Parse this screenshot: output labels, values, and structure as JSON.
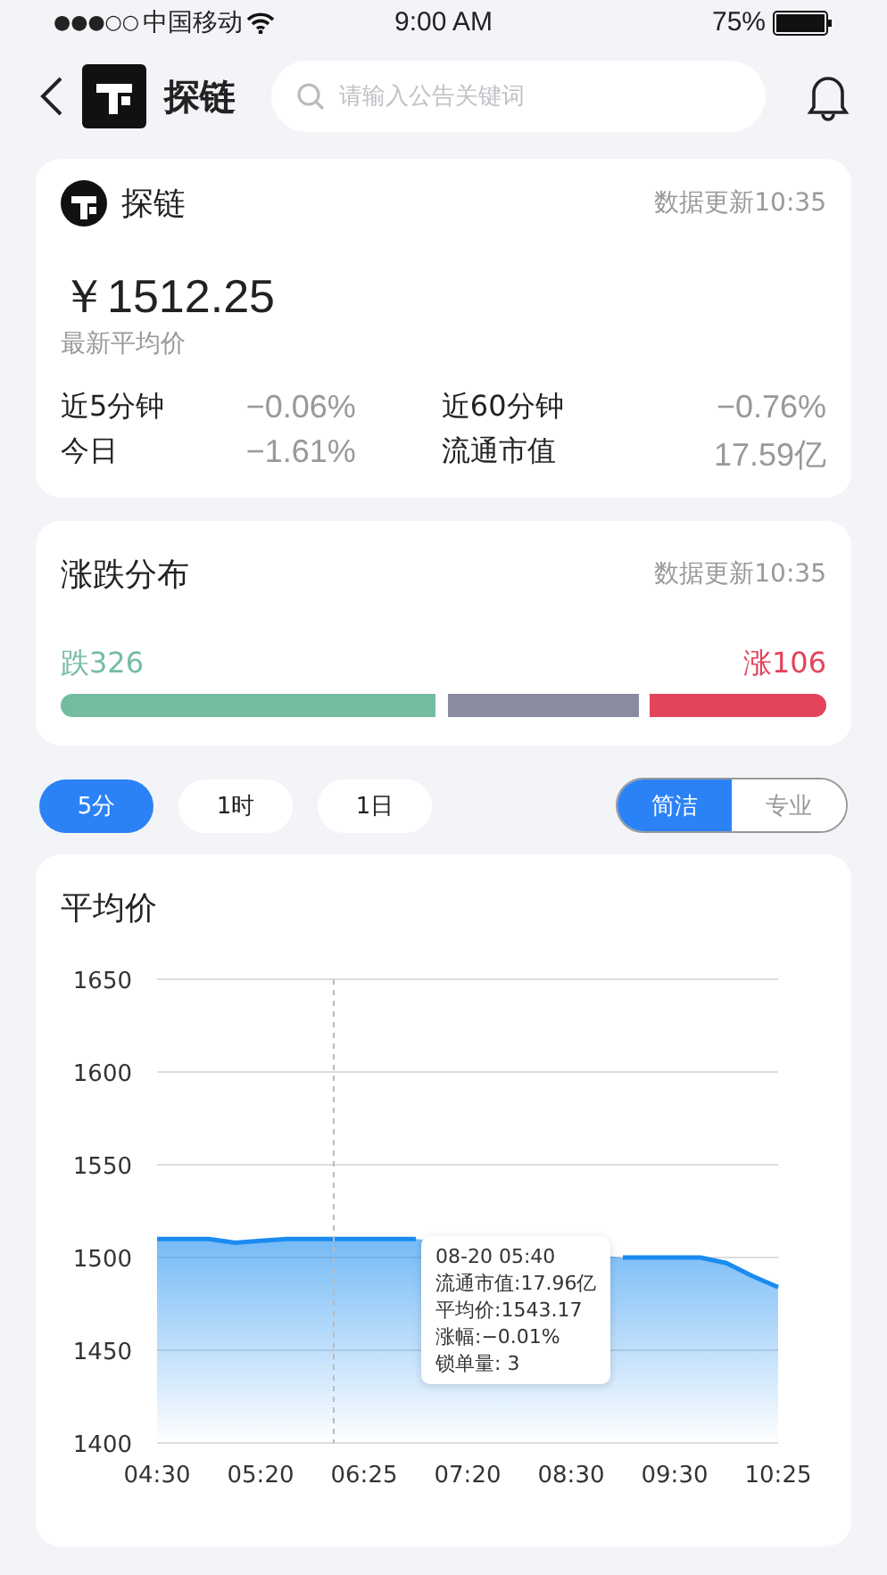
{
  "status_bar": {
    "signal": "●●●○○",
    "carrier": "中国移动",
    "time": "9:00 AM",
    "battery": "75%"
  },
  "header": {
    "brand": "探链",
    "search": {
      "placeholder": "请输入公告关键词"
    }
  },
  "summary": {
    "name": "探链",
    "updated": "数据更新10:35",
    "price": "￥1512.25",
    "price_label": "最新平均价",
    "stats": [
      {
        "label": "近5分钟",
        "value": "−0.06%"
      },
      {
        "label": "近60分钟",
        "value": "−0.76%"
      },
      {
        "label": "今日",
        "value": "−1.61%"
      },
      {
        "label": "流通市值",
        "value": "17.59亿"
      }
    ]
  },
  "distribution": {
    "title": "涨跌分布",
    "updated": "数据更新10:35",
    "down_label": "跌326",
    "up_label": "涨106",
    "segments": [
      {
        "color": "#74bc9f"
      },
      {
        "color": "#8a8ba0"
      },
      {
        "color": "#e2445c"
      }
    ]
  },
  "periods": [
    {
      "label": "5分",
      "selected": true
    },
    {
      "label": "1时",
      "selected": false
    },
    {
      "label": "1日",
      "selected": false
    }
  ],
  "modes": [
    {
      "label": "简洁",
      "selected": true
    },
    {
      "label": "专业",
      "selected": false
    }
  ],
  "chart": {
    "title": "平均价",
    "tooltip": [
      "08-20 05:40",
      "流通市值:17.96亿",
      "平均价:1543.17",
      "涨幅:−0.01%",
      "锁单量: 3"
    ],
    "chart_data": {
      "type": "area",
      "categories": [
        "04:30",
        null,
        null,
        null,
        "05:20",
        null,
        null,
        null,
        "06:25",
        null,
        null,
        null,
        "07:20",
        null,
        null,
        null,
        "08:30",
        null,
        null,
        null,
        "09:30",
        null,
        null,
        null,
        "10:25"
      ],
      "series": [
        {
          "color": "#1a8cf0",
          "values": [
            1510,
            1510,
            1510,
            1508,
            1509,
            1510,
            1510,
            1510,
            1510,
            1510,
            1510,
            null,
            null,
            null,
            null,
            null,
            null,
            null,
            1500,
            1500,
            1500,
            1500,
            1497,
            1490,
            1484
          ]
        }
      ],
      "ylim": [
        1400,
        1650
      ],
      "grid": true,
      "yticks": [
        1400,
        1450,
        1500,
        1550,
        1600,
        1650
      ]
    }
  }
}
